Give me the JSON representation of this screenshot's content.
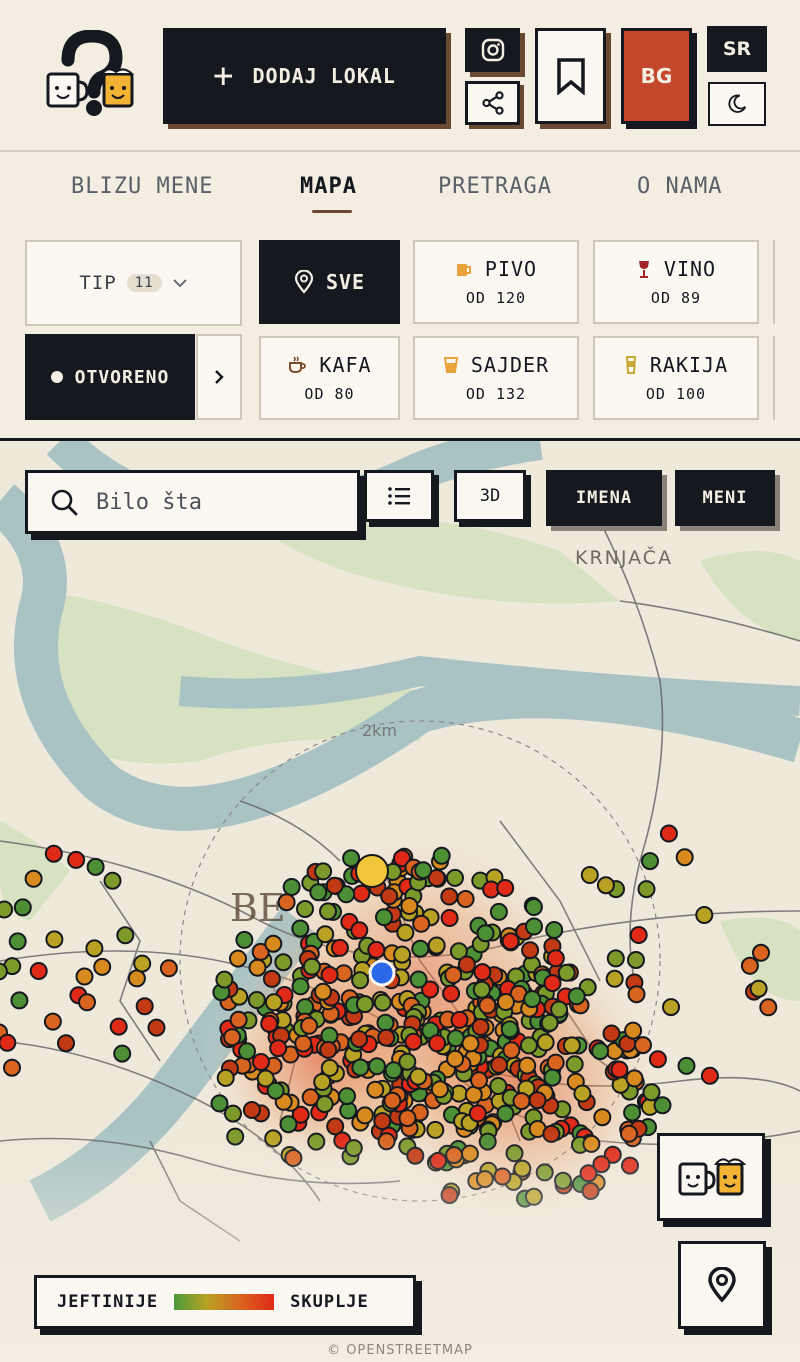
{
  "header": {
    "add_label": "DODAJ LOKAL",
    "bg_label": "BG",
    "lang_label": "SR"
  },
  "nav": {
    "items": [
      "BLIZU MENE",
      "MAPA",
      "PRETRAGA",
      "O NAMA"
    ],
    "active": "MAPA"
  },
  "filters": {
    "tip_label": "TIP",
    "tip_count": "11",
    "open_label": "OTVORENO",
    "categories": [
      {
        "label": "SVE",
        "price": "",
        "icon": "pin-icon"
      },
      {
        "label": "PIVO",
        "price": "OD 120",
        "icon": "beer-icon"
      },
      {
        "label": "VINO",
        "price": "OD 89",
        "icon": "wine-icon"
      },
      {
        "label": "KAFA",
        "price": "OD 80",
        "icon": "coffee-icon"
      },
      {
        "label": "SAJDER",
        "price": "OD 132",
        "icon": "cider-icon"
      },
      {
        "label": "RAKIJA",
        "price": "OD 100",
        "icon": "rakija-icon"
      }
    ]
  },
  "map": {
    "search_placeholder": "Bilo šta",
    "btn_3d": "3D",
    "btn_names": "IMENA",
    "btn_menu": "MENI",
    "scale": "2km",
    "place_label": "KRNJAČA",
    "city_label_fragment": "BE",
    "legend_cheap": "JEFTINIJE",
    "legend_expensive": "SKUPLJE",
    "attribution": "© OPENSTREETMAP"
  },
  "colors": {
    "dark": "#15191f",
    "accent_red": "#c4472b",
    "shadow_brown": "#6b4a33",
    "background": "#f3ede2",
    "cheap": "#4c9a3a",
    "expensive": "#e02a17"
  }
}
